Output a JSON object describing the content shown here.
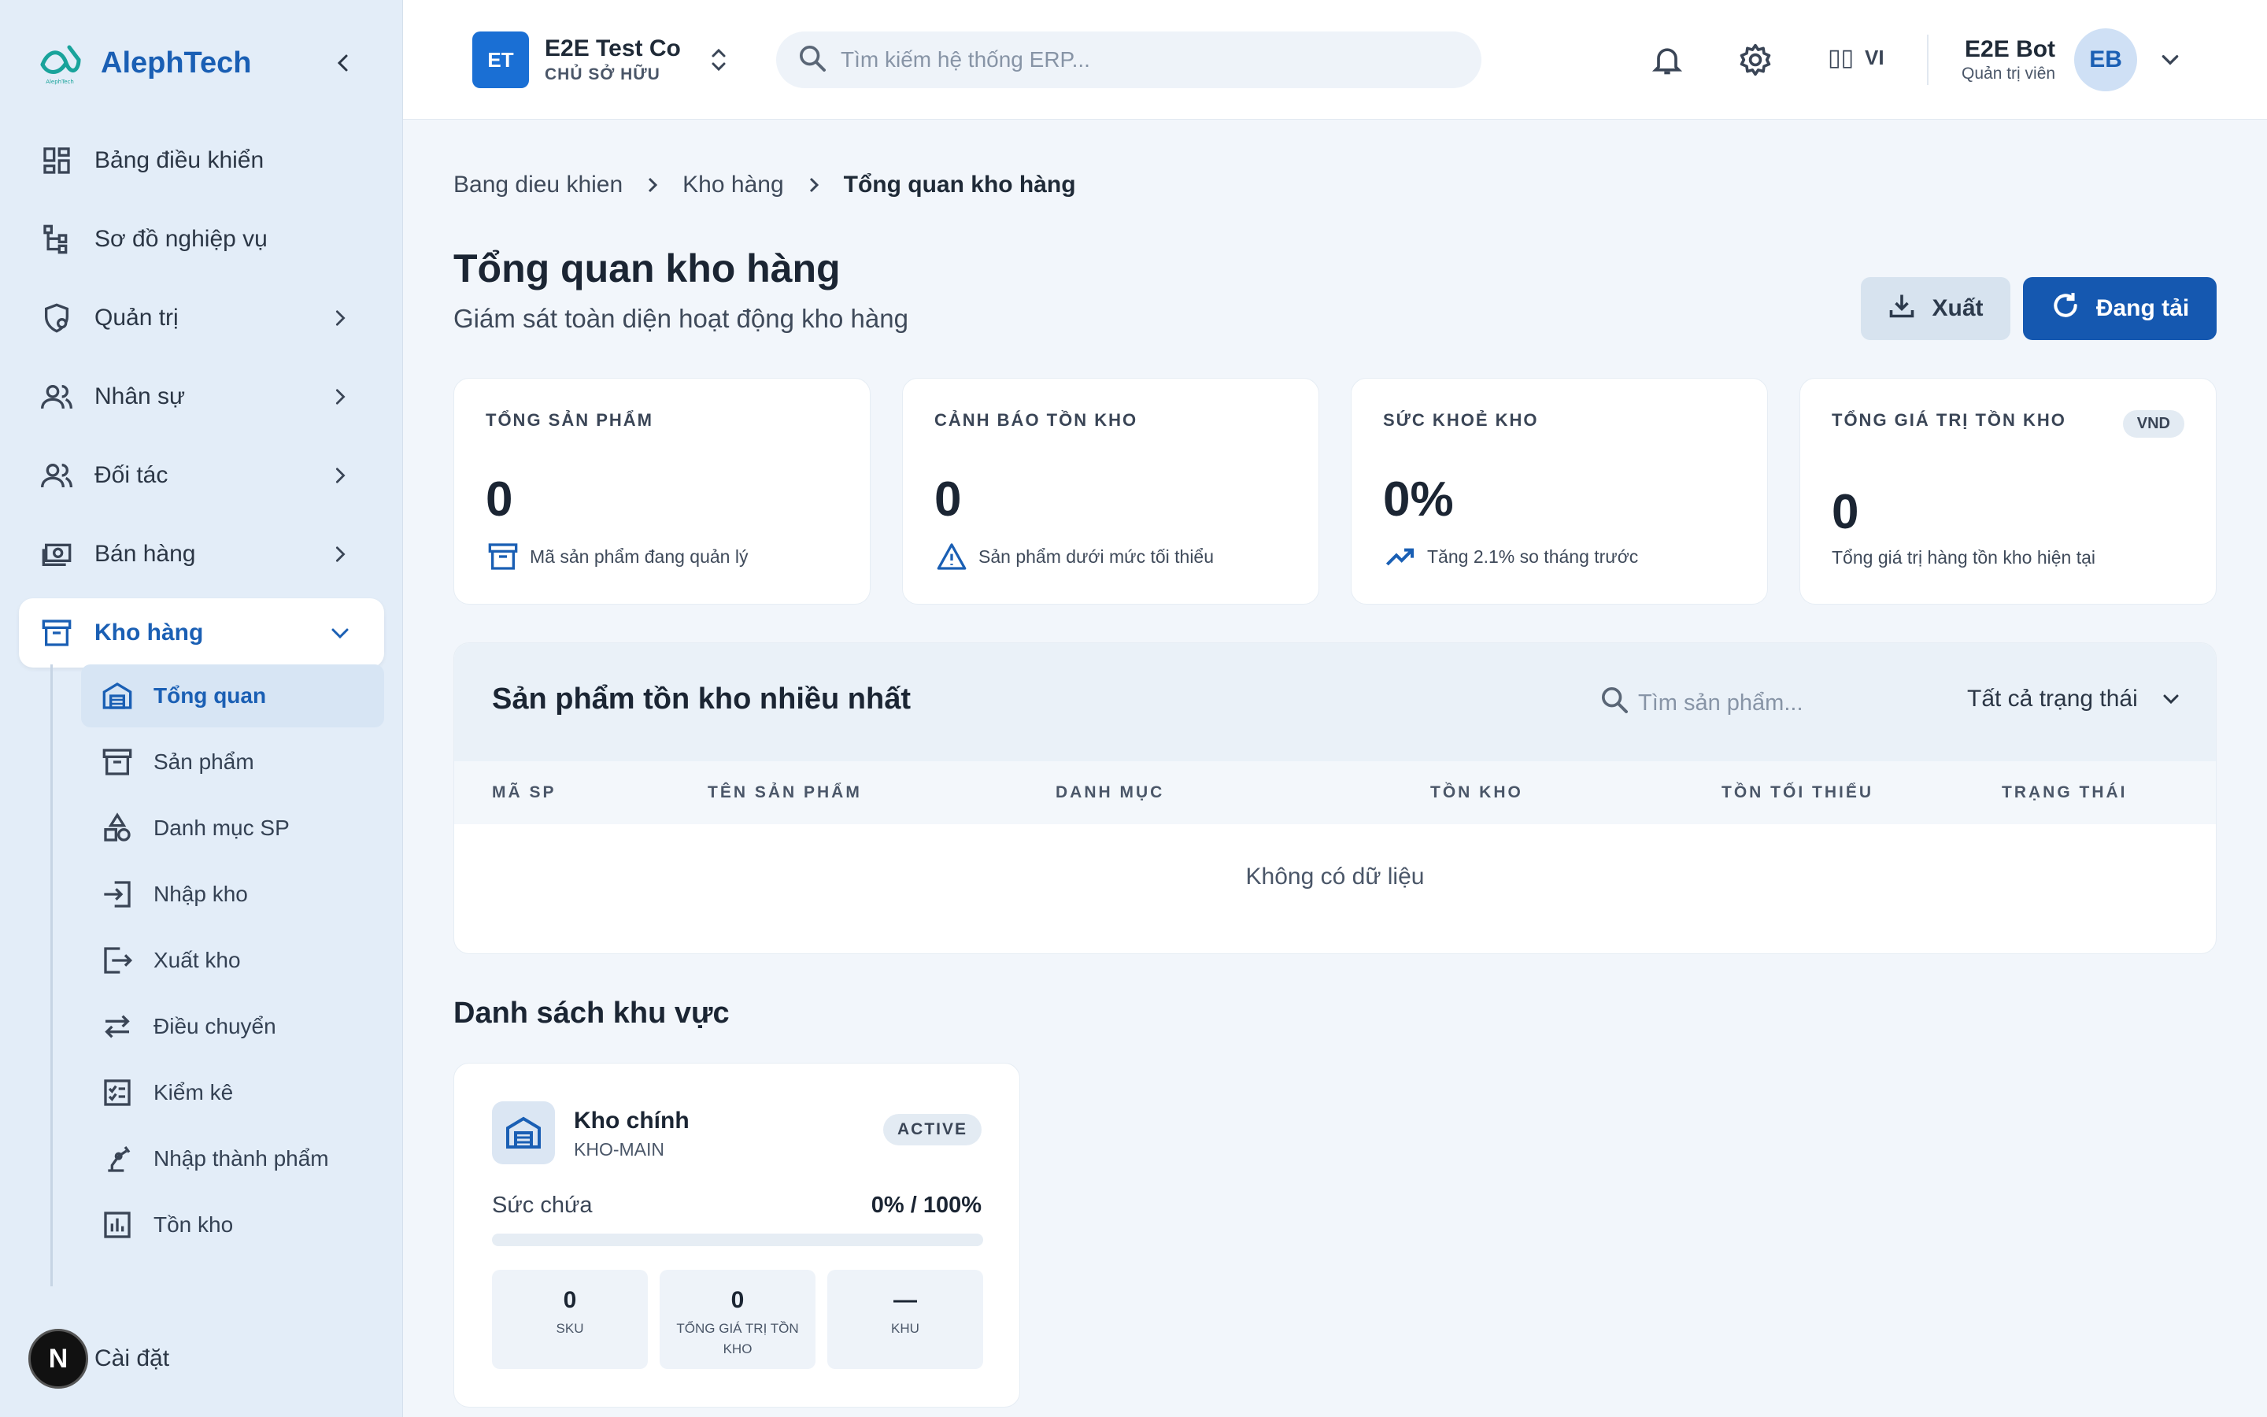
{
  "brand": {
    "name": "AlephTech",
    "logo_caption": "AlephTech"
  },
  "sidebar": {
    "items": [
      {
        "label": "Bảng điều khiển",
        "icon": "dashboard-icon"
      },
      {
        "label": "Sơ đồ nghiệp vụ",
        "icon": "workflow-icon"
      },
      {
        "label": "Quản trị",
        "icon": "admin-shield-icon"
      },
      {
        "label": "Nhân sự",
        "icon": "people-icon"
      },
      {
        "label": "Đối tác",
        "icon": "partners-icon"
      },
      {
        "label": "Bán hàng",
        "icon": "cash-icon"
      },
      {
        "label": "Kho hàng",
        "icon": "warehouse-box-icon"
      }
    ],
    "sub_items": [
      {
        "label": "Tổng quan",
        "icon": "warehouse-icon"
      },
      {
        "label": "Sản phẩm",
        "icon": "archive-icon"
      },
      {
        "label": "Danh mục SP",
        "icon": "category-icon"
      },
      {
        "label": "Nhập kho",
        "icon": "import-icon"
      },
      {
        "label": "Xuất kho",
        "icon": "export-icon"
      },
      {
        "label": "Điều chuyển",
        "icon": "transfer-icon"
      },
      {
        "label": "Kiểm kê",
        "icon": "checklist-icon"
      },
      {
        "label": "Nhập thành phẩm",
        "icon": "robot-arm-icon"
      },
      {
        "label": "Tồn kho",
        "icon": "bar-chart-icon"
      }
    ],
    "footer": {
      "badge": "N",
      "label": "Cài đặt"
    }
  },
  "header": {
    "org": {
      "initials": "ET",
      "name": "E2E Test Co",
      "role": "CHỦ SỞ HỮU"
    },
    "search_placeholder": "Tìm kiếm hệ thống ERP...",
    "language": {
      "flag": "▯▯",
      "code": "VI"
    },
    "user": {
      "name": "E2E Bot",
      "role": "Quản trị viên",
      "initials": "EB"
    }
  },
  "breadcrumb": [
    "Bang dieu khien",
    "Kho hàng",
    "Tổng quan kho hàng"
  ],
  "page": {
    "title": "Tổng quan kho hàng",
    "subtitle": "Giám sát toàn diện hoạt động kho hàng",
    "export_label": "Xuất",
    "reload_label": "Đang tải"
  },
  "stats": [
    {
      "label": "TỔNG SẢN PHẨM",
      "value": "0",
      "desc": "Mã sản phẩm đang quản lý",
      "icon": "archive-icon"
    },
    {
      "label": "CẢNH BÁO TỒN KHO",
      "value": "0",
      "desc": "Sản phẩm dưới mức tối thiểu",
      "icon": "warning-icon"
    },
    {
      "label": "SỨC KHOẺ KHO",
      "value": "0%",
      "desc": "Tăng 2.1% so tháng trước",
      "icon": "trending-up-icon"
    },
    {
      "label": "TỔNG GIÁ TRỊ TỒN KHO",
      "value": "0",
      "desc": "Tổng giá trị hàng tồn kho hiện tại",
      "badge": "VND"
    }
  ],
  "top_products": {
    "title": "Sản phẩm tồn kho nhiều nhất",
    "search_placeholder": "Tìm sản phẩm...",
    "status_filter": "Tất cả trạng thái",
    "columns": [
      "MÃ SP",
      "TÊN SẢN PHẨM",
      "DANH MỤC",
      "TỒN KHO",
      "TỒN TỐI THIỂU",
      "TRẠNG THÁI"
    ],
    "empty_text": "Không có dữ liệu"
  },
  "zones": {
    "title": "Danh sách khu vực",
    "items": [
      {
        "name": "Kho chính",
        "code": "KHO-MAIN",
        "status": "ACTIVE",
        "capacity_label": "Sức chứa",
        "capacity_value": "0% / 100%",
        "capacity_fraction": 0,
        "stats": [
          {
            "value": "0",
            "label": "SKU"
          },
          {
            "value": "0",
            "label": "TỔNG GIÁ TRỊ TỒN KHO"
          },
          {
            "value": "—",
            "label": "KHU"
          }
        ]
      }
    ]
  },
  "colors": {
    "primary": "#1558b0",
    "accent": "#1a6fd4",
    "sidebar_bg": "#e3edf8",
    "page_bg": "#f2f6fb"
  }
}
